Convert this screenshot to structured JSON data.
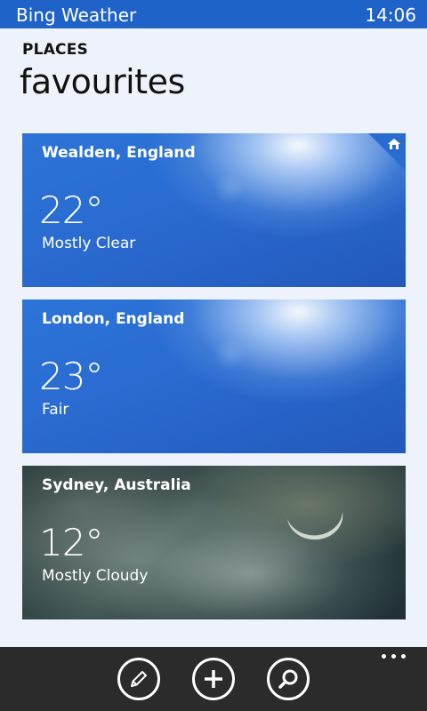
{
  "status_bar": {
    "app_title": "Bing Weather",
    "time": "14:06",
    "color": "#1f62c8"
  },
  "header": {
    "section": "PLACES",
    "title": "favourites"
  },
  "favourites": [
    {
      "location": "Wealden, England",
      "temperature": "22°",
      "condition": "Mostly Clear",
      "is_home": true,
      "theme": "sunny"
    },
    {
      "location": "London, England",
      "temperature": "23°",
      "condition": "Fair",
      "is_home": false,
      "theme": "sunny"
    },
    {
      "location": "Sydney, Australia",
      "temperature": "12°",
      "condition": "Mostly Cloudy",
      "is_home": false,
      "theme": "cloudy-night"
    }
  ],
  "app_bar": {
    "buttons": [
      {
        "icon": "edit-icon"
      },
      {
        "icon": "add-icon"
      },
      {
        "icon": "search-icon"
      }
    ],
    "more_icon": "more-icon"
  }
}
